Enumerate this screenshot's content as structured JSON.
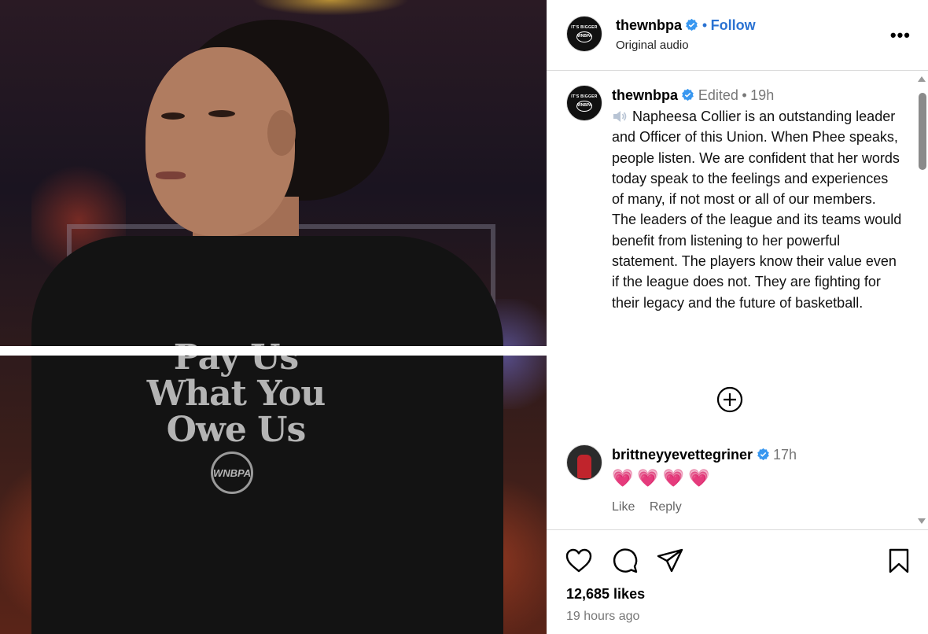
{
  "post": {
    "shirt_lines": [
      "Pay Us",
      "What You",
      "Owe Us"
    ],
    "shirt_logo": "WNBPA"
  },
  "header": {
    "username": "thewnbpa",
    "follow_label": "Follow",
    "separator": "•",
    "audio_label": "Original audio",
    "more_label": "•••"
  },
  "caption": {
    "username": "thewnbpa",
    "edited_label": "Edited",
    "separator": "•",
    "time": "19h",
    "text": "Napheesa Collier is an outstanding leader and Officer of this Union. When Phee speaks, people listen. We are confident that her words today speak to the feelings and experiences of many, if not most or all of our members. The leaders of the league and its teams would benefit from listening to her powerful statement. The players know their value even if the league does not. They are fighting for their legacy and the future of basketball."
  },
  "comment": {
    "username": "brittneyyevettegriner",
    "time": "17h",
    "text": "💗💗💗💗",
    "like_label": "Like",
    "reply_label": "Reply"
  },
  "footer": {
    "likes": "12,685 likes",
    "posted": "19 hours ago"
  },
  "colors": {
    "accent": "#2a72d2",
    "verified": "#3897f0",
    "heart": "#e8345a"
  },
  "icons": [
    "heart-icon",
    "comment-icon",
    "share-icon",
    "bookmark-icon",
    "plus-circle-icon",
    "verified-icon",
    "speaker-icon",
    "more-icon"
  ]
}
